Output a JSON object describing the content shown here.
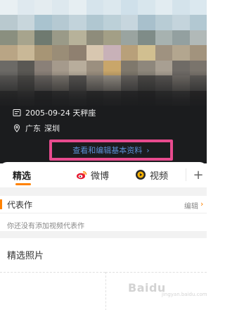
{
  "profile": {
    "birthdate": "2005-09-24 天秤座",
    "location_province": "广东",
    "location_city": "深圳",
    "edit_profile_label": "查看和编辑基本资料",
    "edit_profile_chevron": "›"
  },
  "tabs": [
    {
      "label": "精选",
      "selected": true
    },
    {
      "label": "微博",
      "icon": "weibo-icon"
    },
    {
      "label": "视频",
      "icon": "video-icon"
    }
  ],
  "tabs_more": "+",
  "representative": {
    "title": "代表作",
    "edit_label": "编辑",
    "edit_chevron": "›",
    "empty_text": "你还没有添加视频代表作"
  },
  "photos": {
    "title": "精选照片"
  },
  "watermark": {
    "text": "Baidu",
    "sub": "jingyan.baidu.com"
  },
  "colors": {
    "accent": "#ff8200",
    "highlight_border": "#e84b8e",
    "link": "#5b8fd4",
    "header_bg": "#1b1c1e"
  }
}
